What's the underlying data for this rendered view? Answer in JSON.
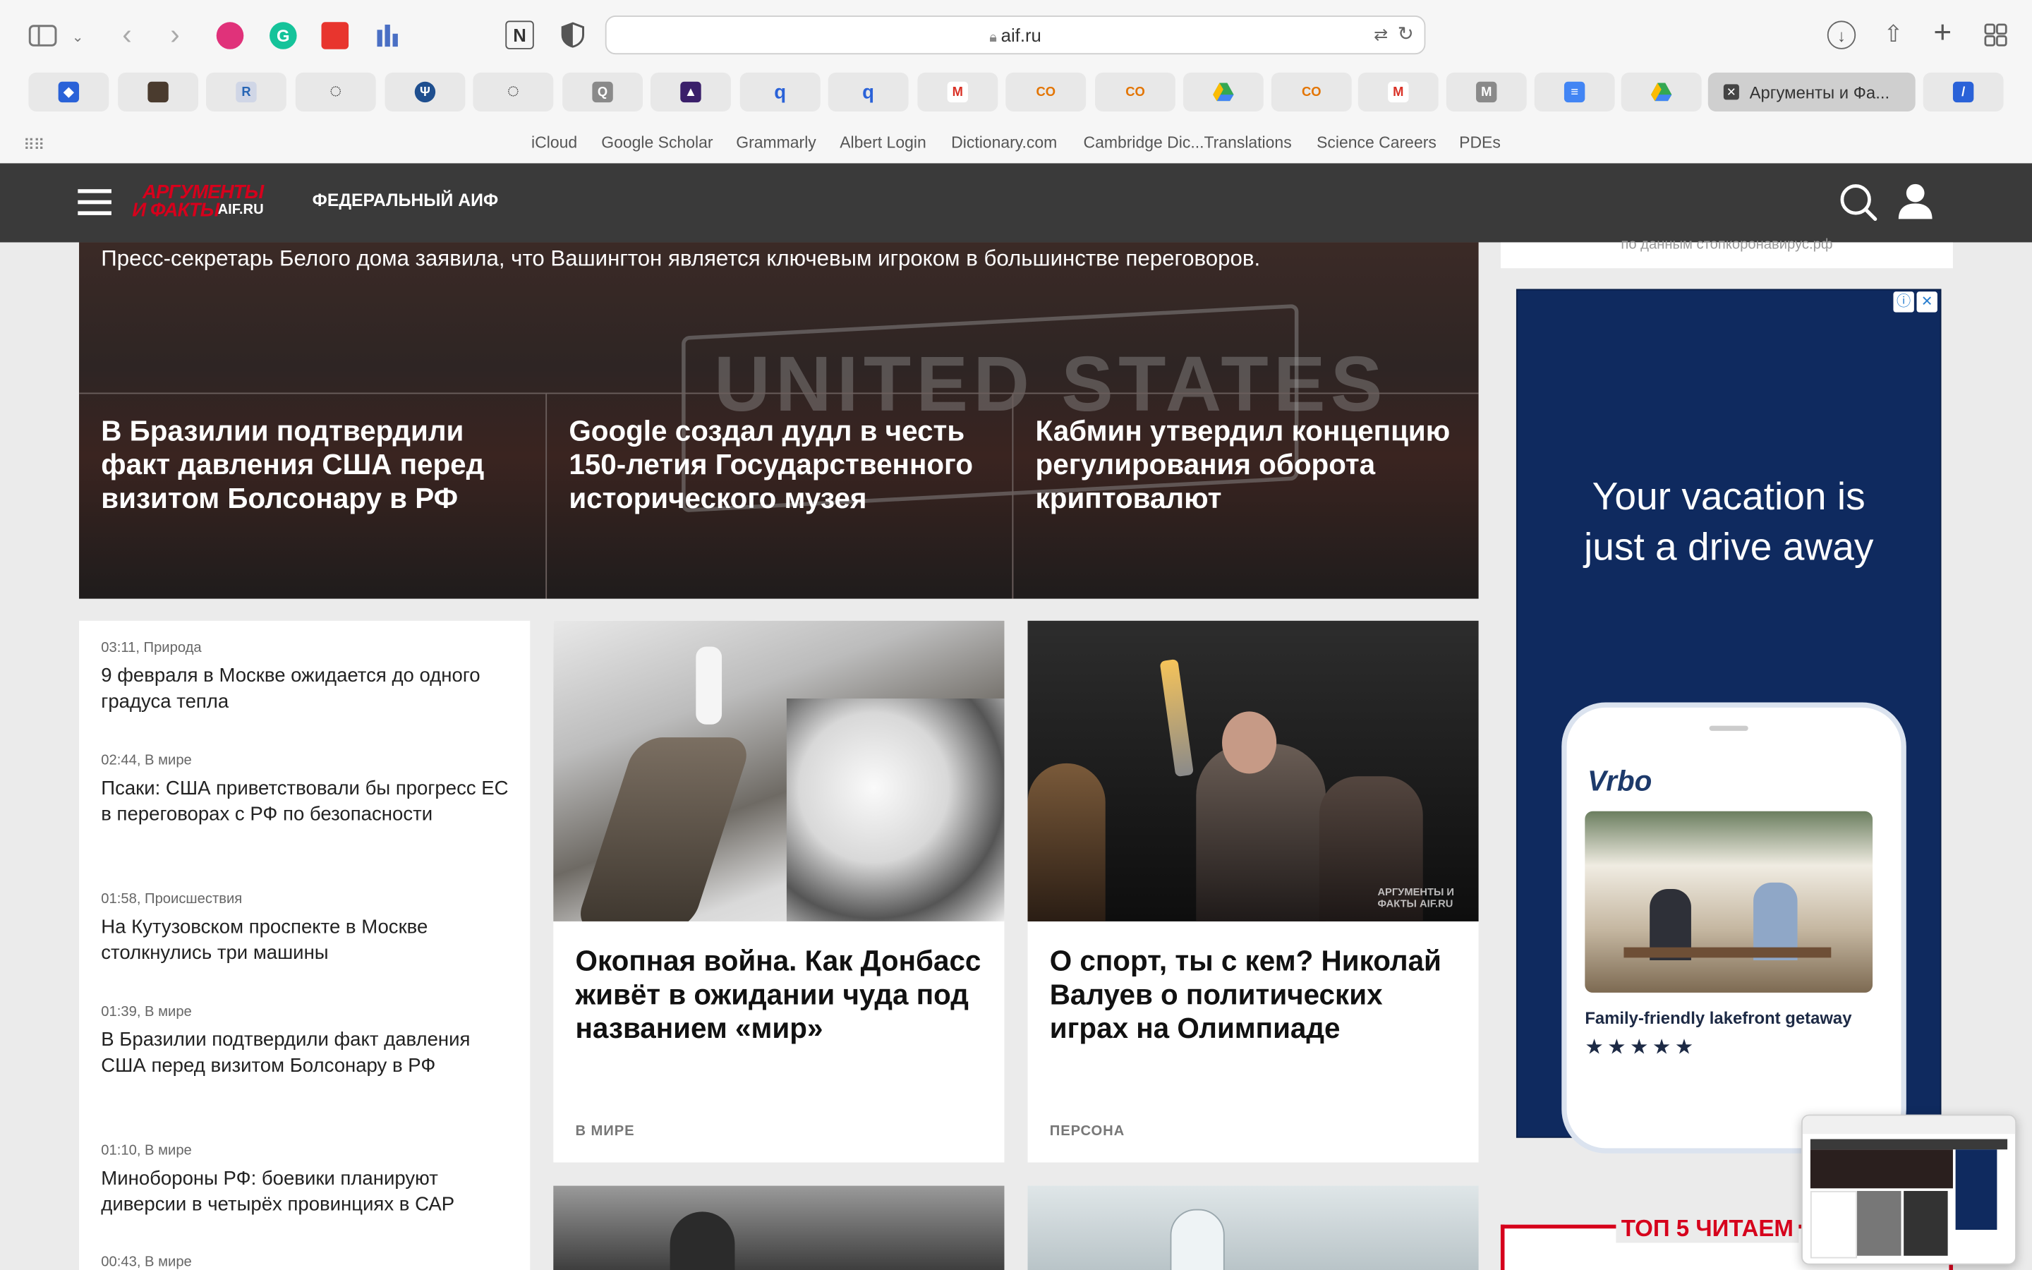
{
  "browser": {
    "url": "aif.ru",
    "active_tab": "Аргументы и Фа...",
    "bookmarks": [
      "iCloud",
      "Google Scholar",
      "Grammarly",
      "Albert Login",
      "Dictionary.com",
      "Cambridge Dic...Translations",
      "Science Careers",
      "PDEs"
    ]
  },
  "site": {
    "logo_line1": "АРГУМЕНТЫ",
    "logo_line2": "И ФАКТЫ",
    "logo_domain": "AIF.RU",
    "section": "ФЕДЕРАЛЬНЫЙ АИФ"
  },
  "lead": {
    "subtitle": "Пресс-секретарь Белого дома заявила, что Вашингтон является ключевым игроком в большинстве переговоров.",
    "bg_sign": "UNITED STATES",
    "headlines": [
      "В Бразилии подтвердили факт давления США перед визитом Болсонару в РФ",
      "Google создал дудл в честь 150-летия Государственного исторического музея",
      "Кабмин утвердил концепцию регулирования оборота криптовалют"
    ]
  },
  "news_list": [
    {
      "meta": "03:11, Природа",
      "title": "9 февраля в Москве ожидается до одного градуса тепла"
    },
    {
      "meta": "02:44, В мире",
      "title": "Псаки: США приветствовали бы прогресс ЕС в переговорах с РФ по безопасности"
    },
    {
      "meta": "01:58, Происшествия",
      "title": "На Кутузовском проспекте в Москве столкнулись три машины"
    },
    {
      "meta": "01:39, В мире",
      "title": "В Бразилии подтвердили факт давления США перед визитом Болсонару в РФ"
    },
    {
      "meta": "01:10, В мире",
      "title": "Минобороны РФ: боевики планируют диверсии в четырёх провинциях в САР"
    },
    {
      "meta": "00:43, В мире",
      "title": ""
    }
  ],
  "cards": [
    {
      "title": "Окопная война. Как Донбасс живёт в ожидании чуда под названием «мир»",
      "category": "В МИРЕ"
    },
    {
      "title": "О спорт, ты с кем? Николай Валуев о политических играх на Олимпиаде",
      "category": "ПЕРСОНА",
      "watermark": "АРГУМЕНТЫ И ФАКТЫ AIF.RU"
    }
  ],
  "sidebar": {
    "covid_source": "по данным стопкоронавирус.рф",
    "ad_headline": "Your vacation is just a drive away",
    "ad_brand": "Vrbo",
    "ad_caption": "Family-friendly lakefront getaway",
    "ad_rating": 5,
    "top5_label": "ТОП 5 ЧИТАЕМ"
  },
  "colors": {
    "brand_red": "#d6001c",
    "header": "#3a3a3a",
    "ad_bg": "#0f2a5f"
  }
}
